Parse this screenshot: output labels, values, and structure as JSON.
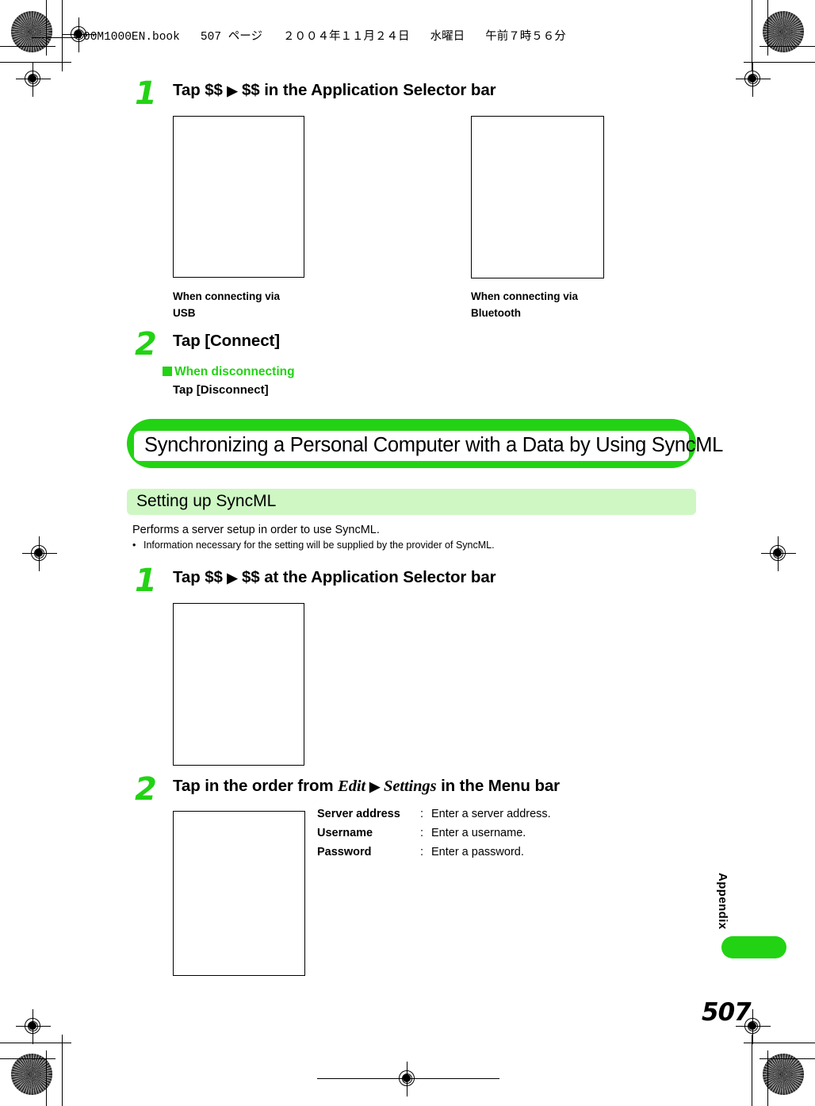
{
  "page": {
    "header_slug": "00M1000EN.book   507 ページ   ２００４年１１月２４日   水曜日   午前７時５６分",
    "number": "507",
    "side_tab_label": "Appendix"
  },
  "colors": {
    "accent_green": "#22d313",
    "light_green": "#cef7c4",
    "text": "#000000"
  },
  "steps_top": [
    {
      "number": "1",
      "title_prefix": "Tap $$ ",
      "arrow": "▶",
      "title_suffix": " $$ in the Application Selector bar"
    },
    {
      "number": "2",
      "title": "Tap [Connect]"
    }
  ],
  "screenshots_top": [
    {
      "caption_line1": "When connecting via",
      "caption_line2": "USB"
    },
    {
      "caption_line1": "When connecting via",
      "caption_line2": "Bluetooth"
    }
  ],
  "disconnect_note": {
    "heading": "When disconnecting",
    "body": "Tap [Disconnect]"
  },
  "section": {
    "banner_title": "Synchronizing a Personal Computer with a Data by Using SyncML",
    "sub_banner_title": "Setting up SyncML",
    "intro": "Performs a server setup in order to use SyncML.",
    "bullet": "Information necessary for the setting will be supplied by the provider of SyncML."
  },
  "steps_bottom": [
    {
      "number": "1",
      "title_prefix": "Tap $$ ",
      "arrow": "▶",
      "title_suffix": " $$ at the Application Selector bar"
    },
    {
      "number": "2",
      "title_prefix": "Tap in the order from ",
      "italic1": "Edit",
      "arrow": "▶",
      "italic2": "Settings",
      "title_suffix": " in the Menu bar"
    }
  ],
  "settings_table": {
    "rows": [
      {
        "term": "Server address",
        "sep": ":",
        "desc": "Enter a server address."
      },
      {
        "term": "Username",
        "sep": ":",
        "desc": "Enter a username."
      },
      {
        "term": "Password",
        "sep": ":",
        "desc": "Enter a password."
      }
    ]
  }
}
